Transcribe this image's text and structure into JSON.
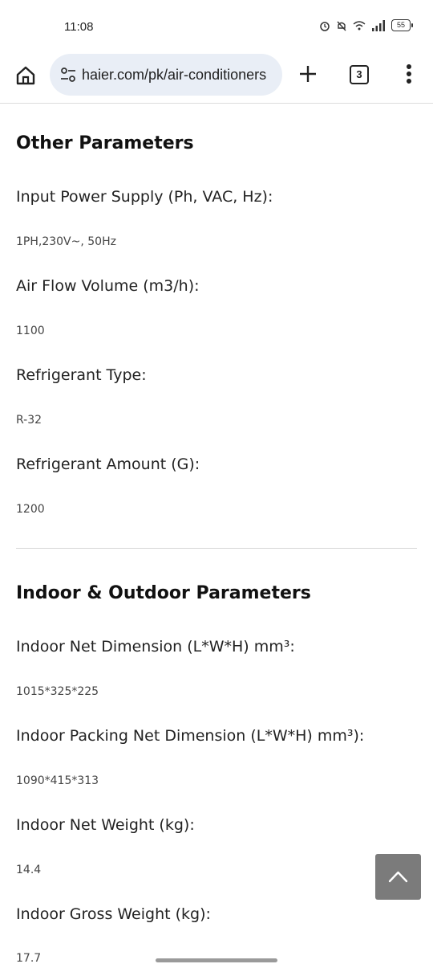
{
  "status_bar": {
    "time": "11:08",
    "battery": "55",
    "icons": [
      "alarm-icon",
      "mute-icon",
      "wifi-icon",
      "signal-icon",
      "battery-icon"
    ]
  },
  "browser": {
    "url": "haier.com/pk/air-conditioners",
    "tab_count": "3",
    "icons": [
      "home-icon",
      "tune-icon",
      "plus-icon",
      "tabs-icon",
      "more-vert-icon"
    ]
  },
  "sections": {
    "other": {
      "title": "Other Parameters",
      "params": [
        {
          "label": "Input Power Supply (Ph, VAC, Hz):",
          "value": "1PH,230V~, 50Hz"
        },
        {
          "label": "Air Flow Volume (m3/h):",
          "value": "1100"
        },
        {
          "label": "Refrigerant Type:",
          "value": "R-32"
        },
        {
          "label": "Refrigerant Amount (G):",
          "value": "1200"
        }
      ]
    },
    "indoor_outdoor": {
      "title": "Indoor & Outdoor Parameters",
      "params": [
        {
          "label": "Indoor Net Dimension (L*W*H) mm³:",
          "value": "1015*325*225"
        },
        {
          "label": "Indoor Packing Net Dimension (L*W*H) mm³):",
          "value": "1090*415*313"
        },
        {
          "label": "Indoor Net Weight (kg):",
          "value": "14.4"
        },
        {
          "label": "Indoor Gross Weight (kg):",
          "value": "17.7"
        }
      ]
    }
  },
  "colors": {
    "url_pill": "#e9eef6",
    "scroll_button": "#7b7b7b",
    "divider": "#d6d6d6"
  }
}
